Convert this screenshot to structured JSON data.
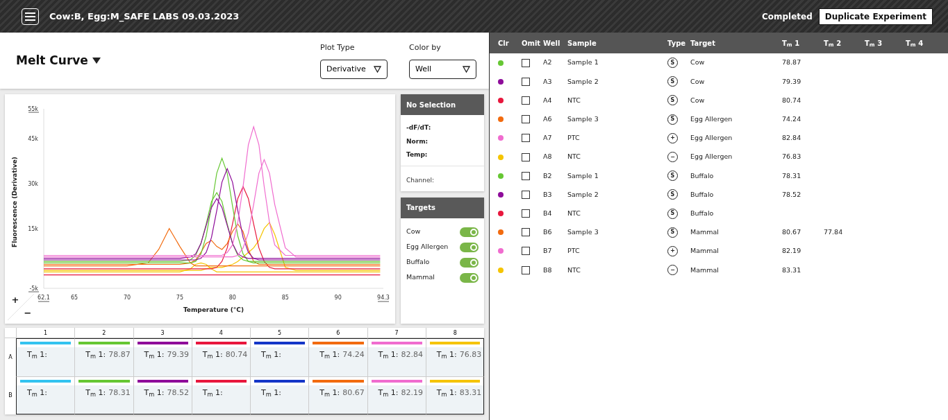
{
  "header": {
    "title": "Cow:B, Egg:M_SAFE LABS 09.03.2023",
    "status": "Completed",
    "action": "Duplicate Experiment"
  },
  "view": {
    "title": "Melt Curve",
    "plot_type": {
      "label": "Plot Type",
      "value": "Derivative"
    },
    "color_by": {
      "label": "Color by",
      "value": "Well"
    }
  },
  "chart": {
    "zoom_in": "+",
    "zoom_out": "−",
    "chart_data": {
      "type": "line",
      "xlabel": "Temperature (°C)",
      "ylabel": "Fluorescence (Derivative)",
      "xlim": [
        62.1,
        94.3
      ],
      "ylim": [
        -5,
        55
      ],
      "xticks": [
        {
          "value": 62.1,
          "label": "62.1"
        },
        {
          "value": 65,
          "label": "65"
        },
        {
          "value": 70,
          "label": "70"
        },
        {
          "value": 75,
          "label": "75"
        },
        {
          "value": 80,
          "label": "80"
        },
        {
          "value": 85,
          "label": "85"
        },
        {
          "value": 90,
          "label": "90"
        },
        {
          "value": 94.3,
          "label": "94.3"
        }
      ],
      "yticks": [
        {
          "value": 55,
          "label": "55k"
        },
        {
          "value": 45,
          "label": "45k"
        },
        {
          "value": 30,
          "label": "30k"
        },
        {
          "value": 15,
          "label": "15k"
        },
        {
          "value": -5,
          "label": "-5k"
        }
      ],
      "x": [
        62.1,
        64,
        66,
        68,
        70,
        72,
        73,
        74,
        75,
        76,
        76.5,
        77,
        77.5,
        78,
        78.5,
        79,
        79.5,
        80,
        80.5,
        81,
        81.5,
        82,
        82.5,
        83,
        83.5,
        84,
        85,
        86,
        88,
        90,
        92,
        94
      ],
      "series": [
        {
          "color": "#e8173d",
          "values": [
            -0.5,
            -0.5,
            -0.5,
            -0.5,
            -0.5,
            -0.5,
            -0.5,
            -0.5,
            -0.5,
            -0.5,
            -0.5,
            -0.5,
            -0.5,
            -0.5,
            -0.5,
            -0.5,
            -0.5,
            -0.5,
            -0.5,
            -0.5,
            -0.5,
            -0.5,
            -0.5,
            -0.5,
            -0.5,
            -0.5,
            -0.5,
            -0.5,
            -0.5,
            -0.5,
            -0.5,
            -0.5
          ]
        },
        {
          "color": "#f5c400",
          "values": [
            0.5,
            0.5,
            0.5,
            0.5,
            0.5,
            0.5,
            0.5,
            0.5,
            0.5,
            1.5,
            3,
            3.5,
            3,
            1.5,
            0.5,
            0.5,
            0.5,
            0.5,
            0.5,
            0.5,
            0.5,
            0.5,
            0.5,
            0.5,
            0.5,
            0.5,
            0.5,
            0.5,
            0.5,
            0.5,
            0.5,
            0.5
          ]
        },
        {
          "color": "#f5c400",
          "values": [
            1,
            1,
            1,
            1,
            1,
            1,
            1,
            1,
            1,
            1,
            1,
            1,
            1.5,
            2,
            2,
            2,
            2.5,
            3,
            4,
            5.5,
            7,
            8.5,
            11,
            15,
            17,
            13,
            2,
            1,
            1,
            1,
            1,
            1
          ]
        },
        {
          "color": "#e8173d",
          "values": [
            1.5,
            1.5,
            1.5,
            1.5,
            1.5,
            1.5,
            1.5,
            1.5,
            1.5,
            1.5,
            1.5,
            1.5,
            1.5,
            1.5,
            2,
            4,
            8.5,
            16.5,
            25,
            29,
            25,
            16.5,
            8.5,
            4,
            2,
            1.5,
            1.5,
            1.5,
            1.5,
            1.5,
            1.5,
            1.5
          ]
        },
        {
          "color": "#f26b0f",
          "values": [
            2.5,
            2.5,
            2.5,
            2.5,
            2.5,
            3.5,
            8,
            15,
            9,
            3.5,
            2.5,
            2.5,
            2.5,
            2.5,
            2.5,
            2.5,
            2.5,
            2.5,
            2.5,
            2.5,
            2.5,
            2.5,
            2.5,
            2.5,
            2.5,
            2.5,
            2.5,
            2.5,
            2.5,
            2.5,
            2.5,
            2.5
          ]
        },
        {
          "color": "#f26b0f",
          "values": [
            3,
            3,
            3,
            3,
            3,
            3,
            3,
            3,
            3,
            3.5,
            4.5,
            7,
            10,
            11,
            9,
            8,
            10,
            14,
            16.5,
            14,
            8,
            4,
            3,
            3,
            3,
            3,
            3,
            3,
            3,
            3,
            3,
            3
          ]
        },
        {
          "color": "#66c733",
          "values": [
            3.5,
            3.5,
            3.5,
            3.5,
            3.5,
            3.5,
            3.5,
            3.5,
            3.5,
            3.5,
            4,
            6.5,
            12.5,
            22.5,
            33.5,
            38.5,
            33.5,
            22.5,
            12.5,
            6.5,
            4,
            3.5,
            3.5,
            3.5,
            3.5,
            3.5,
            3.5,
            3.5,
            3.5,
            3.5,
            3.5,
            3.5
          ]
        },
        {
          "color": "#66c733",
          "values": [
            4,
            4,
            4,
            4,
            4,
            4,
            4,
            4,
            4,
            4.5,
            6,
            10,
            16.5,
            24,
            27,
            24,
            16.5,
            10,
            6,
            4.5,
            4,
            4,
            4,
            4,
            4,
            4,
            4,
            4,
            4,
            4,
            4,
            4
          ]
        },
        {
          "color": "#8e0c9a",
          "values": [
            4.5,
            4.5,
            4.5,
            4.5,
            4.5,
            4.5,
            4.5,
            4.5,
            4.5,
            4.5,
            4.5,
            5,
            7,
            12,
            21,
            30.5,
            35,
            30.5,
            21,
            12,
            7,
            5,
            4.5,
            4.5,
            4.5,
            4.5,
            4.5,
            4.5,
            4.5,
            4.5,
            4.5,
            4.5
          ]
        },
        {
          "color": "#8e0c9a",
          "values": [
            5,
            5,
            5,
            5,
            5,
            5,
            5,
            5,
            5,
            5.5,
            6.5,
            10,
            16,
            22,
            25,
            22,
            16,
            10,
            6.5,
            5.5,
            5,
            5,
            5,
            5,
            5,
            5,
            5,
            5,
            5,
            5,
            5,
            5
          ]
        },
        {
          "color": "#f06ccf",
          "values": [
            5.5,
            5.5,
            5.5,
            5.5,
            5.5,
            5.5,
            5.5,
            5.5,
            5.5,
            5.5,
            5.5,
            5.5,
            5.5,
            5.5,
            5.5,
            5.5,
            5.5,
            5.5,
            6,
            8.5,
            13.5,
            23,
            33.5,
            38,
            33.5,
            23,
            8.5,
            5.5,
            5.5,
            5.5,
            5.5,
            5.5
          ]
        },
        {
          "color": "#f06ccf",
          "values": [
            6,
            6,
            6,
            6,
            6,
            6,
            6,
            6,
            6,
            6,
            6,
            6,
            6,
            6,
            6,
            6,
            7,
            9.5,
            17,
            29,
            43,
            49,
            43,
            29,
            17,
            9.5,
            6,
            6,
            6,
            6,
            6,
            6
          ]
        }
      ]
    }
  },
  "selection": {
    "title": "No Selection",
    "fields": [
      "-dF/dT:",
      "Norm:",
      "Temp:"
    ],
    "channel": "Channel:"
  },
  "targets": {
    "title": "Targets",
    "items": [
      {
        "label": "Cow",
        "on": true
      },
      {
        "label": "Egg Allergen",
        "on": true
      },
      {
        "label": "Buffalo",
        "on": true
      },
      {
        "label": "Mammal",
        "on": true
      }
    ]
  },
  "plate": {
    "columns": [
      "1",
      "2",
      "3",
      "4",
      "5",
      "6",
      "7",
      "8"
    ],
    "rows": [
      {
        "label": "A",
        "wells": [
          {
            "color": "#33c3f0",
            "tm_label": "T$_{m}$ 1:"
          },
          {
            "color": "#66c733",
            "tm_label": "T$_{m}$ 1:",
            "tm": "78.87"
          },
          {
            "color": "#8e0c9a",
            "tm_label": "T$_{m}$ 1:",
            "tm": "79.39"
          },
          {
            "color": "#e8173d",
            "tm_label": "T$_{m}$ 1:",
            "tm": "80.74"
          },
          {
            "color": "#1436c8",
            "tm_label": "T$_{m}$ 1:"
          },
          {
            "color": "#f26b0f",
            "tm_label": "T$_{m}$ 1:",
            "tm": "74.24"
          },
          {
            "color": "#f06ccf",
            "tm_label": "T$_{m}$ 1:",
            "tm": "82.84"
          },
          {
            "color": "#f5c400",
            "tm_label": "T$_{m}$ 1:",
            "tm": "76.83"
          }
        ]
      },
      {
        "label": "B",
        "wells": [
          {
            "color": "#33c3f0",
            "tm_label": "T$_{m}$ 1:"
          },
          {
            "color": "#66c733",
            "tm_label": "T$_{m}$ 1:",
            "tm": "78.31"
          },
          {
            "color": "#8e0c9a",
            "tm_label": "T$_{m}$ 1:",
            "tm": "78.52"
          },
          {
            "color": "#e8173d",
            "tm_label": "T$_{m}$ 1:"
          },
          {
            "color": "#1436c8",
            "tm_label": "T$_{m}$ 1:"
          },
          {
            "color": "#f26b0f",
            "tm_label": "T$_{m}$ 1:",
            "tm": "80.67"
          },
          {
            "color": "#f06ccf",
            "tm_label": "T$_{m}$ 1:",
            "tm": "82.19"
          },
          {
            "color": "#f5c400",
            "tm_label": "T$_{m}$ 1:",
            "tm": "83.31"
          }
        ]
      }
    ]
  },
  "table": {
    "columns": [
      "Clr",
      "Omit",
      "Well",
      "Sample",
      "Type",
      "Target",
      "T$_{m}$ 1",
      "T$_{m}$ 2",
      "T$_{m}$ 3",
      "T$_{m}$ 4"
    ],
    "rows": [
      {
        "color": "#66c733",
        "omit": false,
        "well": "A2",
        "sample": "Sample 1",
        "type": "S",
        "target": "Cow",
        "tm1": "78.87"
      },
      {
        "color": "#8e0c9a",
        "omit": false,
        "well": "A3",
        "sample": "Sample 2",
        "type": "S",
        "target": "Cow",
        "tm1": "79.39"
      },
      {
        "color": "#e8173d",
        "omit": false,
        "well": "A4",
        "sample": "NTC",
        "type": "S",
        "target": "Cow",
        "tm1": "80.74"
      },
      {
        "color": "#f26b0f",
        "omit": false,
        "well": "A6",
        "sample": "Sample 3",
        "type": "S",
        "target": "Egg Allergen",
        "tm1": "74.24"
      },
      {
        "color": "#f06ccf",
        "omit": false,
        "well": "A7",
        "sample": "PTC",
        "type": "+",
        "target": "Egg Allergen",
        "tm1": "82.84"
      },
      {
        "color": "#f5c400",
        "omit": false,
        "well": "A8",
        "sample": "NTC",
        "type": "−",
        "target": "Egg Allergen",
        "tm1": "76.83"
      },
      {
        "color": "#66c733",
        "omit": false,
        "well": "B2",
        "sample": "Sample 1",
        "type": "S",
        "target": "Buffalo",
        "tm1": "78.31"
      },
      {
        "color": "#8e0c9a",
        "omit": false,
        "well": "B3",
        "sample": "Sample 2",
        "type": "S",
        "target": "Buffalo",
        "tm1": "78.52"
      },
      {
        "color": "#e8173d",
        "omit": false,
        "well": "B4",
        "sample": "NTC",
        "type": "S",
        "target": "Buffalo"
      },
      {
        "color": "#f26b0f",
        "omit": false,
        "well": "B6",
        "sample": "Sample 3",
        "type": "S",
        "target": "Mammal",
        "tm1": "80.67",
        "tm2": "77.84"
      },
      {
        "color": "#f06ccf",
        "omit": false,
        "well": "B7",
        "sample": "PTC",
        "type": "+",
        "target": "Mammal",
        "tm1": "82.19"
      },
      {
        "color": "#f5c400",
        "omit": false,
        "well": "B8",
        "sample": "NTC",
        "type": "−",
        "target": "Mammal",
        "tm1": "83.31"
      }
    ]
  }
}
